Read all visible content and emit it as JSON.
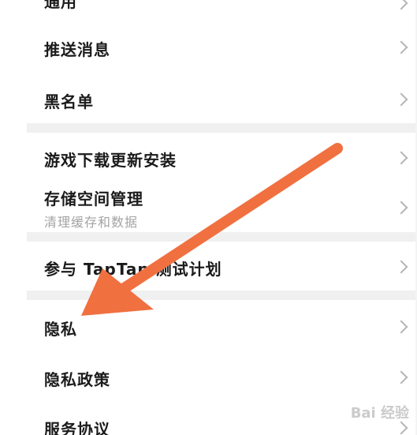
{
  "settings": {
    "items": [
      {
        "title": "通用"
      },
      {
        "title": "推送消息"
      },
      {
        "title": "黑名单"
      },
      {
        "title": "游戏下载更新安装"
      },
      {
        "title": "存储空间管理",
        "subtitle": "清理缓存和数据"
      },
      {
        "title": "参与 TapTap 测试计划"
      },
      {
        "title": "隐私"
      },
      {
        "title": "隐私政策"
      },
      {
        "title": "服务协议"
      }
    ]
  },
  "annotation": {
    "arrow_color": "#f07040"
  },
  "watermark": {
    "text": "Bai 经验"
  }
}
